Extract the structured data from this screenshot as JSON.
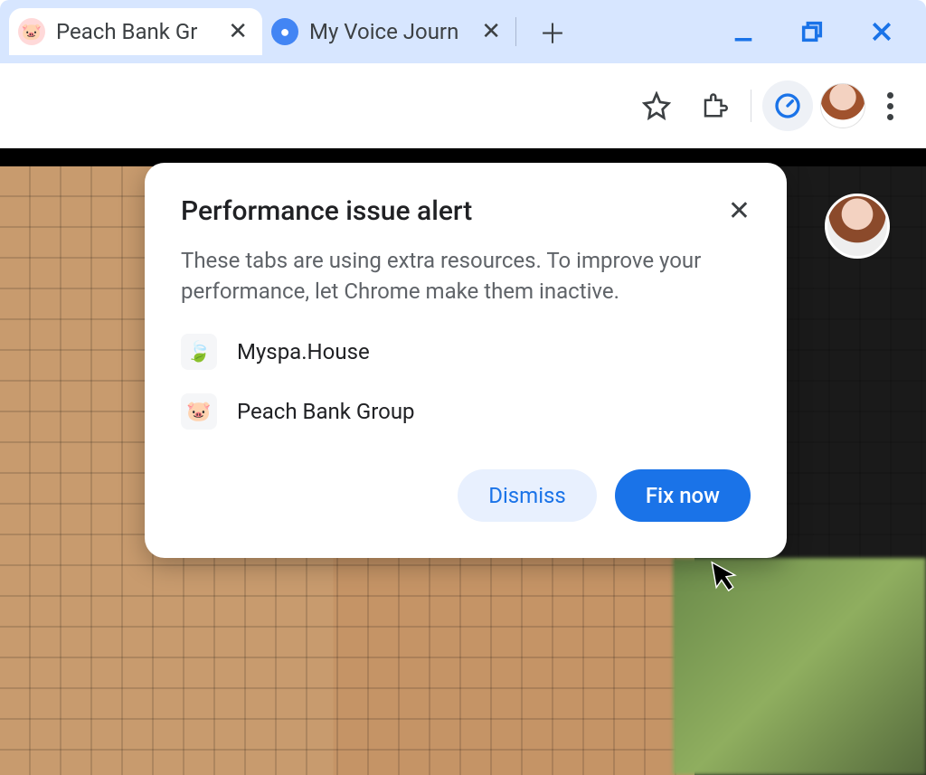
{
  "tabs": [
    {
      "title": "Peach Bank Gr",
      "favicon": "🐷",
      "active": true
    },
    {
      "title": "My Voice Journ",
      "favicon": "🎤",
      "active": false
    }
  ],
  "dialog": {
    "title": "Performance issue alert",
    "body": "These tabs are using extra resources. To improve your performance, let Chrome make them inactive.",
    "items": [
      {
        "name": "Myspa.House",
        "icon": "🍃"
      },
      {
        "name": "Peach Bank Group",
        "icon": "🐷"
      }
    ],
    "dismiss": "Dismiss",
    "fix": "Fix now"
  }
}
